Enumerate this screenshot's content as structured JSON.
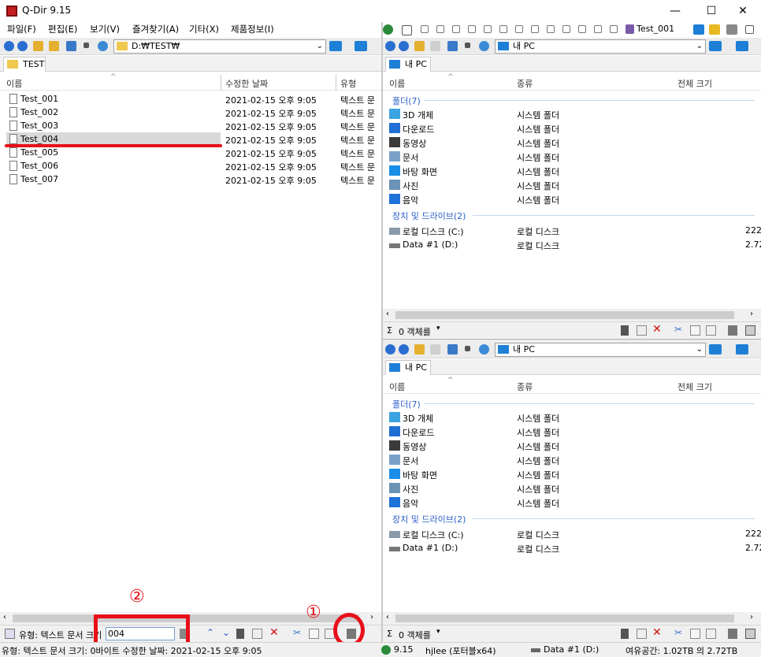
{
  "app": {
    "title": "Q-Dir 9.15"
  },
  "window_controls": {
    "minimize": "—",
    "maximize": "☐",
    "close": "✕"
  },
  "menu": [
    "파일(F)",
    "편집(E)",
    "보기(V)",
    "즐겨찾기(A)",
    "기타(X)",
    "제품정보(I)"
  ],
  "top_right_toolbar": {
    "tab_label": "Test_001"
  },
  "left_pane": {
    "address": "D:₩TEST₩",
    "tab": "TEST",
    "columns": [
      "이름",
      "수정한 날짜",
      "유형"
    ],
    "files": [
      {
        "name": "Test_001",
        "date": "2021-02-15 오후 9:05",
        "type": "텍스트 문"
      },
      {
        "name": "Test_002",
        "date": "2021-02-15 오후 9:05",
        "type": "텍스트 문"
      },
      {
        "name": "Test_003",
        "date": "2021-02-15 오후 9:05",
        "type": "텍스트 문"
      },
      {
        "name": "Test_004",
        "date": "2021-02-15 오후 9:05",
        "type": "텍스트 문"
      },
      {
        "name": "Test_005",
        "date": "2021-02-15 오후 9:05",
        "type": "텍스트 문"
      },
      {
        "name": "Test_006",
        "date": "2021-02-15 오후 9:05",
        "type": "텍스트 문"
      },
      {
        "name": "Test_007",
        "date": "2021-02-15 오후 9:05",
        "type": "텍스트 문"
      }
    ],
    "selected_index": 3,
    "footer": {
      "type_label": "유형: 텍스트 문서 크기",
      "filter_value": "004"
    },
    "statusbar": "유형: 텍스트 문서 크기: 0바이트 수정한 날짜: 2021-02-15 오후 9:05"
  },
  "right_pane_common": {
    "address": "내 PC",
    "tab": "내 PC",
    "columns": [
      "이름",
      "종류",
      "전체 크기"
    ],
    "folders_group": "폴더(7)",
    "folders": [
      {
        "name": "3D 개체",
        "kind": "시스템 폴더",
        "color": "#3ba3e0"
      },
      {
        "name": "다운로드",
        "kind": "시스템 폴더",
        "color": "#1e6fd1"
      },
      {
        "name": "동영상",
        "kind": "시스템 폴더",
        "color": "#3a3a3a"
      },
      {
        "name": "문서",
        "kind": "시스템 폴더",
        "color": "#7aa0c8"
      },
      {
        "name": "바탕 화면",
        "kind": "시스템 폴더",
        "color": "#1a8ee6"
      },
      {
        "name": "사진",
        "kind": "시스템 폴더",
        "color": "#6a93b5"
      },
      {
        "name": "음악",
        "kind": "시스템 폴더",
        "color": "#1e73d8"
      }
    ],
    "drives_group": "장치 및 드라이브(2)",
    "drives": [
      {
        "name": "로컬 디스크 (C:)",
        "kind": "로컬 디스크",
        "size": "222"
      },
      {
        "name": "Data #1 (D:)",
        "kind": "로컬 디스크",
        "size": "2.72"
      }
    ],
    "objects": "0 객체를"
  },
  "bottom_status": {
    "version": "9.15",
    "user": "hjlee (포터블x64)",
    "drive": "Data #1 (D:)",
    "free": "여유공간: 1.02TB 의 2.72TB"
  },
  "annotations": {
    "circle1": "①",
    "circle2": "②"
  },
  "colors": {
    "accent": "#1e6fd1",
    "annotation_red": "#e8101a",
    "selection": "#d9d9d9"
  }
}
